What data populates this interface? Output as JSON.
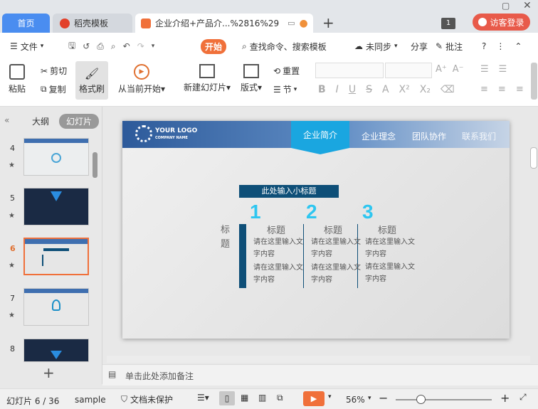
{
  "tabs": {
    "home": "首页",
    "template": "稻壳模板",
    "document": "企业介绍+产品介...%2816%29"
  },
  "header": {
    "page_badge": "1",
    "visitor_login": "访客登录"
  },
  "menu": {
    "file": "文件",
    "start": "开始",
    "search": "查找命令、搜索模板",
    "unsynced": "未同步",
    "share": "分享",
    "comment": "批注"
  },
  "ribbon": {
    "paste": "粘贴",
    "cut": "剪切",
    "copy": "复制",
    "format_painter": "格式刷",
    "play_from_current": "从当前开始",
    "new_slide": "新建幻灯片",
    "layout": "版式",
    "reset": "重置",
    "section": "节"
  },
  "sidebar": {
    "outline_tab": "大纲",
    "slides_tab": "幻灯片",
    "slide_numbers": [
      "4",
      "5",
      "6",
      "7",
      "8"
    ],
    "active": "6"
  },
  "slide": {
    "logo_main": "YOUR LOGO",
    "logo_sub": "COMPANY NAME",
    "nav": [
      "企业简介",
      "企业理念",
      "团队协作",
      "联系我们"
    ],
    "subtitle_box": "此处输入小标题",
    "side_label": "标题",
    "columns": [
      {
        "num": "1",
        "title": "标题",
        "text1": "请在这里输入文字内容",
        "text2": "请在这里输入文字内容"
      },
      {
        "num": "2",
        "title": "标题",
        "text1": "请在这里输入文字内容",
        "text2": "请在这里输入文字内容"
      },
      {
        "num": "3",
        "title": "标题",
        "text1": "请在这里输入文字内容",
        "text2": "请在这里输入文字内容"
      }
    ]
  },
  "notes": {
    "placeholder": "单击此处添加备注"
  },
  "status": {
    "slide_info": "幻灯片 6 / 36",
    "theme": "sample",
    "protect": "文档未保护",
    "zoom": "56%"
  },
  "colors": {
    "accent": "#f0703a",
    "blue": "#4a8df0",
    "navy": "#0e4f78",
    "cyan": "#2ec6f0"
  }
}
